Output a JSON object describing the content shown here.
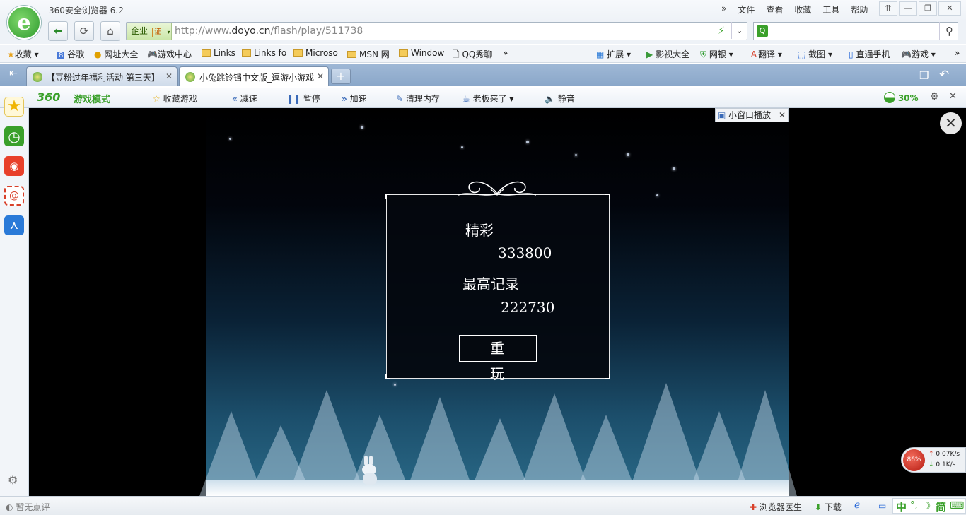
{
  "browser": {
    "title": "360安全浏览器 6.2",
    "logo_letter": "e",
    "menus": [
      "»",
      "文件",
      "查看",
      "收藏",
      "工具",
      "帮助"
    ],
    "window_buttons": [
      "⇈",
      "—",
      "❐",
      "✕"
    ]
  },
  "address": {
    "enterprise_label": "企业",
    "cert_label": "证",
    "url_prefix": "http://www.",
    "url_domain": "doyo.cn",
    "url_path": "/flash/play/511738",
    "search_placeholder": ""
  },
  "bookmarks": {
    "left": [
      {
        "label": "收藏",
        "icon": "star-add-icon"
      },
      {
        "label": "谷歌",
        "icon": "google-icon"
      },
      {
        "label": "网址大全",
        "icon": "globe-icon"
      },
      {
        "label": "游戏中心",
        "icon": "gamepad-icon"
      },
      {
        "label": "Links",
        "icon": "folder-icon"
      },
      {
        "label": "Links fo",
        "icon": "folder-icon"
      },
      {
        "label": "Microso",
        "icon": "folder-icon"
      },
      {
        "label": "MSN 网",
        "icon": "folder-icon"
      },
      {
        "label": "Window",
        "icon": "folder-icon"
      },
      {
        "label": "QQ秀聊",
        "icon": "page-icon"
      }
    ],
    "more": "»",
    "right": [
      {
        "label": "扩展",
        "icon": "extension-icon"
      },
      {
        "label": "影视大全",
        "icon": "video-icon"
      },
      {
        "label": "网银",
        "icon": "shield-icon"
      },
      {
        "label": "翻译",
        "icon": "translate-icon"
      },
      {
        "label": "截图",
        "icon": "screenshot-icon"
      },
      {
        "label": "直通手机",
        "icon": "phone-icon"
      },
      {
        "label": "游戏",
        "icon": "gamepad-icon"
      }
    ]
  },
  "tabs": [
    {
      "title": "【豆粉过年福利活动 第三天】",
      "active": false
    },
    {
      "title": "小兔跳铃铛中文版_逗游小游戏",
      "active": true
    }
  ],
  "gamemode": {
    "brand_number": "360",
    "brand_label": "游戏模式",
    "items": [
      "收藏游戏",
      "减速",
      "暂停",
      "加速",
      "清理内存",
      "老板来了",
      "静音"
    ],
    "percent": "30%"
  },
  "game": {
    "label_great": "精彩",
    "score": "333800",
    "label_best": "最高记录",
    "best_score": "222730",
    "replay_label": "重 玩",
    "mini_window_label": "小窗口播放"
  },
  "netmon": {
    "cpu": "86%",
    "up": "0.07K/s",
    "down": "0.1K/s"
  },
  "statusbar": {
    "left": "暂无点评",
    "doctor": "浏览器医生",
    "download": "下载",
    "ime": "中",
    "ime_mode": "简"
  }
}
